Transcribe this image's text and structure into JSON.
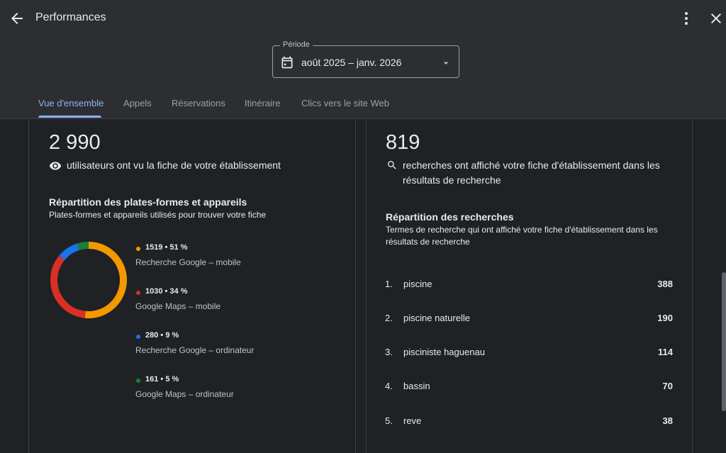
{
  "header": {
    "title": "Performances",
    "period_label": "Période",
    "period_value": "août 2025 – janv. 2026"
  },
  "tabs": [
    {
      "label": "Vue d'ensemble"
    },
    {
      "label": "Appels"
    },
    {
      "label": "Réservations"
    },
    {
      "label": "Itinéraire"
    },
    {
      "label": "Clics vers le site Web"
    }
  ],
  "left_card": {
    "count": "2 990",
    "description": "utilisateurs ont vu la fiche de votre établissement",
    "section_title": "Répartition des plates-formes et appareils",
    "section_subtitle": "Plates-formes et appareils utilisés pour trouver votre fiche",
    "legend": [
      {
        "value": "1519 • 51 %",
        "label": "Recherche Google – mobile",
        "color": "#f29900",
        "share": 51
      },
      {
        "value": "1030 • 34 %",
        "label": "Google Maps – mobile",
        "color": "#d93025",
        "share": 34
      },
      {
        "value": "280 • 9 %",
        "label": "Recherche Google – ordinateur",
        "color": "#1a73e8",
        "share": 9
      },
      {
        "value": "161 • 5 %",
        "label": "Google Maps – ordinateur",
        "color": "#188038",
        "share": 5
      }
    ]
  },
  "right_card": {
    "count": "819",
    "description": "recherches ont affiché votre fiche d'établissement dans les résultats de recherche",
    "section_title": "Répartition des recherches",
    "section_subtitle": "Termes de recherche qui ont affiché votre fiche d'établissement dans les résultats de recherche",
    "terms": [
      {
        "rank": "1.",
        "term": "piscine",
        "count": "388"
      },
      {
        "rank": "2.",
        "term": "piscine naturelle",
        "count": "190"
      },
      {
        "rank": "3.",
        "term": "pisciniste haguenau",
        "count": "114"
      },
      {
        "rank": "4.",
        "term": "bassin",
        "count": "70"
      },
      {
        "rank": "5.",
        "term": "reve",
        "count": "38"
      }
    ]
  },
  "icons": {
    "back": "arrow-back-icon",
    "more": "more-vert-icon",
    "close": "close-icon",
    "calendar": "calendar-icon",
    "dropdown": "arrow-drop-down-icon",
    "views": "eye-icon",
    "search": "search-icon"
  }
}
